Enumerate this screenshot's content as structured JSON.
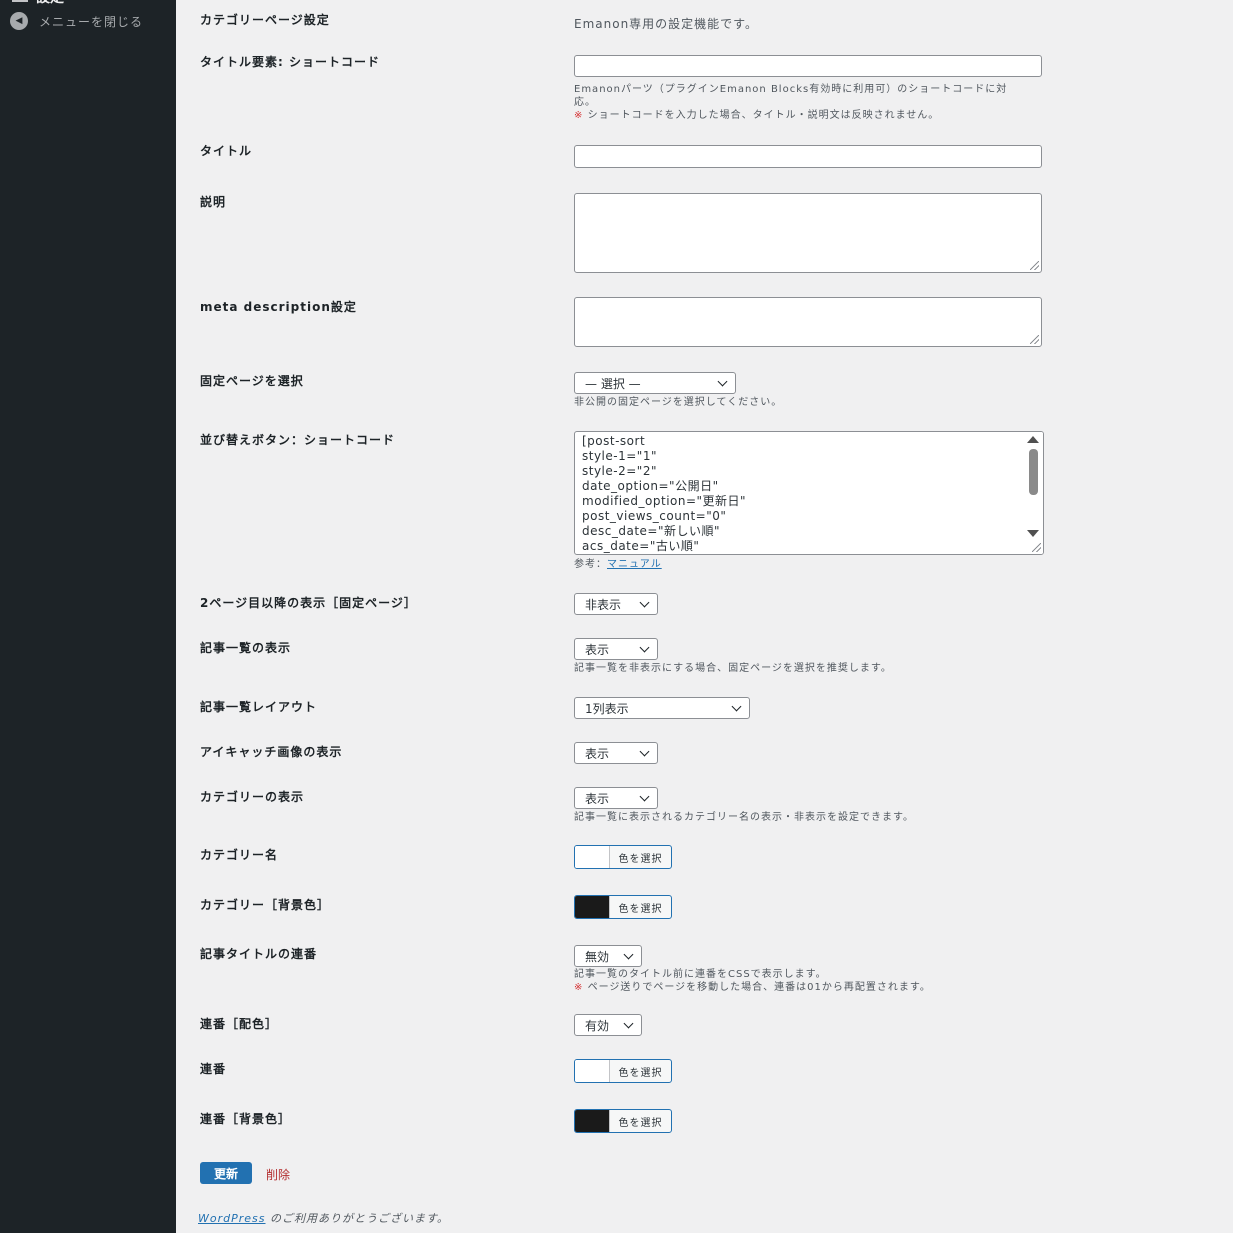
{
  "sidebar": {
    "top_item": "設定",
    "collapse_label": "メニューを閉じる"
  },
  "intro": "Emanon専用の設定機能です。",
  "fields": {
    "category_page": "カテゴリーページ設定",
    "title_shortcode": {
      "label": "タイトル要素: ショートコード",
      "value": "",
      "desc1": "Emanonパーツ（プラグインEmanon Blocks有効時に利用可）のショートコードに対",
      "desc2": "応。",
      "desc3_mark": "※",
      "desc3": "ショートコードを入力した場合、タイトル・説明文は反映されません。"
    },
    "title": {
      "label": "タイトル",
      "value": ""
    },
    "description": {
      "label": "説明",
      "value": ""
    },
    "meta_description": {
      "label": "meta description設定",
      "value": ""
    },
    "fixed_page": {
      "label": "固定ページを選択",
      "selected": "— 選択 —",
      "desc": "非公開の固定ページを選択してください。"
    },
    "sort_shortcode": {
      "label": "並び替えボタン：ショートコード",
      "lines": [
        "[post-sort",
        "style-1=\"1\"",
        "style-2=\"2\"",
        "date_option=\"公開日\"",
        "modified_option=\"更新日\"",
        "post_views_count=\"0\"",
        "desc_date=\"新しい順\"",
        "acs_date=\"古い順\""
      ],
      "ref_prefix": "参考：",
      "ref_link": "マニュアル"
    },
    "page2_display": {
      "label": "2ページ目以降の表示［固定ページ］",
      "selected": "非表示"
    },
    "post_list_display": {
      "label": "記事一覧の表示",
      "selected": "表示",
      "desc": "記事一覧を非表示にする場合、固定ページを選択を推奨します。"
    },
    "post_list_layout": {
      "label": "記事一覧レイアウト",
      "selected": "1列表示"
    },
    "eyecatch_display": {
      "label": "アイキャッチ画像の表示",
      "selected": "表示"
    },
    "category_display": {
      "label": "カテゴリーの表示",
      "selected": "表示",
      "desc": "記事一覧に表示されるカテゴリー名の表示・非表示を設定できます。"
    },
    "category_name_color": {
      "label": "カテゴリー名",
      "button": "色を選択",
      "color": "#ffffff"
    },
    "category_bg_color": {
      "label": "カテゴリー［背景色］",
      "button": "色を選択",
      "color": "#1a1a1a"
    },
    "title_numbering": {
      "label": "記事タイトルの連番",
      "selected": "無効",
      "desc1": "記事一覧のタイトル前に連番をCSSで表示します。",
      "desc2_mark": "※",
      "desc2": "ページ送りでページを移動した場合、連番は01から再配置されます。"
    },
    "numbering_scheme": {
      "label": "連番［配色］",
      "selected": "有効"
    },
    "numbering_color": {
      "label": "連番",
      "button": "色を選択",
      "color": "#ffffff"
    },
    "numbering_bg_color": {
      "label": "連番［背景色］",
      "button": "色を選択",
      "color": "#1a1a1a"
    }
  },
  "actions": {
    "update": "更新",
    "delete": "削除"
  },
  "footer": {
    "link": "WordPress",
    "text": " のご利用ありがとうございます。"
  },
  "colors": {
    "accent": "#2271b1",
    "sidebar": "#1d2327",
    "background": "#f0f0f1",
    "danger": "#d63638"
  }
}
